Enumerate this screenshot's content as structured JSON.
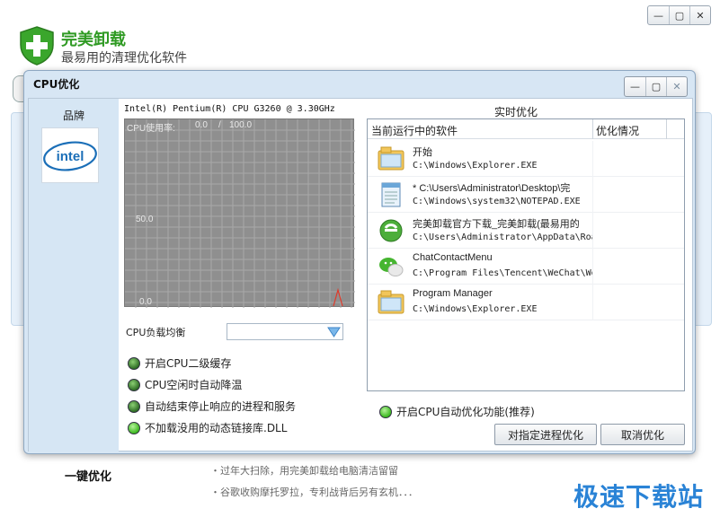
{
  "main_window": {
    "app_name": "完美卸载",
    "slogan": "最易用的清理优化软件",
    "controls": [
      "—",
      "▢",
      "✕"
    ],
    "oneclick_label": "一键优化",
    "news": [
      "・过年大扫除，用完美卸载给电脑清洁留留",
      "・谷歌收购摩托罗拉，专利战背后另有玄机．．．"
    ],
    "watermark": "极速下载站"
  },
  "dialog": {
    "title": "CPU优化",
    "controls": [
      "—",
      "▢",
      "✕"
    ],
    "brand_label": "品牌",
    "brand_logo_text": "intel",
    "cpu_name": "Intel(R) Pentium(R) CPU G3260 @ 3.30GHz",
    "graph": {
      "usage_label": "CPU使用率:",
      "usage_current": "0.0",
      "usage_sep": "/",
      "usage_max": "100.0",
      "mid_label": "50.0",
      "min_label": "0.0"
    },
    "balance_label": "CPU负载均衡",
    "balance_value": "",
    "options": [
      {
        "label": "开启CPU二级缓存",
        "state": "dark"
      },
      {
        "label": "CPU空闲时自动降温",
        "state": "dark"
      },
      {
        "label": "自动结束停止响应的进程和服务",
        "state": "dark"
      },
      {
        "label": "不加载没用的动态链接库.DLL",
        "state": "bright"
      }
    ],
    "realtime_title": "实时优化",
    "list_headers": {
      "software": "当前运行中的软件",
      "status": "优化情况"
    },
    "processes": [
      {
        "name": "开始",
        "path": "C:\\Windows\\Explorer.EXE",
        "icon": "folder-icon"
      },
      {
        "name": "* C:\\Users\\Administrator\\Desktop\\完",
        "path": "C:\\Windows\\system32\\NOTEPAD.EXE",
        "icon": "notepad-icon"
      },
      {
        "name": "完美卸载官方下载_完美卸载(最易用的",
        "path": "C:\\Users\\Administrator\\AppData\\Roa",
        "icon": "ie-browser-icon"
      },
      {
        "name": "ChatContactMenu",
        "path": "C:\\Program Files\\Tencent\\WeChat\\We",
        "icon": "wechat-icon"
      },
      {
        "name": "Program Manager",
        "path": "C:\\Windows\\Explorer.EXE",
        "icon": "folder-icon"
      }
    ],
    "auto_opt_label": "开启CPU自动优化功能(推荐)",
    "btn_optimize": "对指定进程优化",
    "btn_cancel": "取消优化"
  },
  "colors": {
    "accent_green": "#2f9a23",
    "dialog_bg": "#d7e6f4",
    "watermark_blue": "#2a83d6"
  }
}
